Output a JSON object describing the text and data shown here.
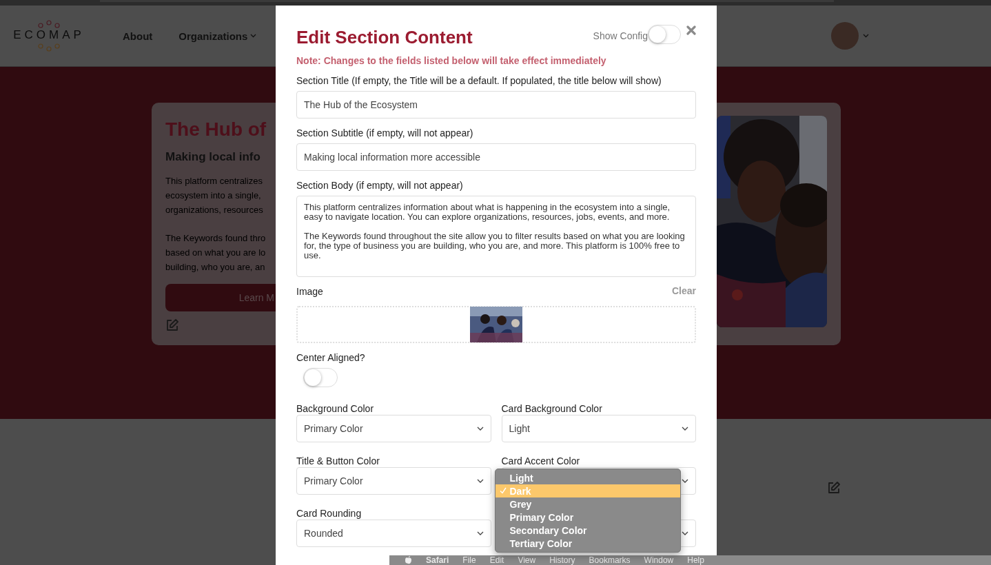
{
  "header": {
    "logo": "ECOMAP",
    "nav": [
      {
        "label": "About",
        "dropdown": false
      },
      {
        "label": "Organizations",
        "dropdown": true
      }
    ]
  },
  "hero": {
    "title": "The Hub of",
    "subtitle": "Making local info",
    "paragraphs": [
      [
        "This platform centralizes",
        "ecosystem into a single,",
        "organizations, resources"
      ],
      [
        "The Keywords found thro",
        "based on what you are lo",
        "building, who you are, an"
      ]
    ],
    "button": "Learn M"
  },
  "modal": {
    "title": "Edit Section Content",
    "show_config": {
      "label": "Show Config",
      "on": false
    },
    "note": "Note: Changes to the fields listed below will take effect immediately",
    "fields": [
      {
        "kind": "text",
        "label": "Section Title (If empty, the Title will be a default. If populated, the title below will show)",
        "value": "The Hub of the Ecosystem"
      },
      {
        "kind": "text",
        "label": "Section Subtitle (if empty, will not appear)",
        "value": "Making local information more accessible"
      },
      {
        "kind": "textarea",
        "label": "Section Body (if empty, will not appear)",
        "paragraphs": [
          "This platform centralizes information about what is happening in the ecosystem into a single, easy to navigate location. You can explore organizations, resources, jobs, events, and more.",
          "The Keywords found throughout the site allow you to filter results based on what you are looking for, the type of business you are building, who you are, and more. This platform is 100% free to use."
        ]
      },
      {
        "label": "Image",
        "action": "Clear"
      },
      {
        "kind": "toggle",
        "label": "Center Aligned?",
        "on": false
      }
    ],
    "selects": [
      {
        "label": "Background Color",
        "value": "Primary Color",
        "open": false
      },
      {
        "label": "Card Background Color",
        "value": "Light",
        "open": false
      },
      {
        "label": "Title & Button Color",
        "value": "Primary Color",
        "open": false
      },
      {
        "label": "Card Accent Color",
        "open": true,
        "options": [
          {
            "label": "Light",
            "selected": false
          },
          {
            "label": "Dark",
            "selected": true
          },
          {
            "label": "Grey",
            "selected": false
          },
          {
            "label": "Primary Color",
            "selected": false
          },
          {
            "label": "Secondary Color",
            "selected": false
          },
          {
            "label": "Tertiary Color",
            "selected": false
          }
        ]
      },
      {
        "label": "Card Rounding",
        "value": "Rounded",
        "open": false
      },
      {
        "open": false
      }
    ]
  },
  "menubar": {
    "app": "Safari",
    "items": [
      "File",
      "Edit",
      "View",
      "History",
      "Bookmarks",
      "Window",
      "Help"
    ]
  }
}
